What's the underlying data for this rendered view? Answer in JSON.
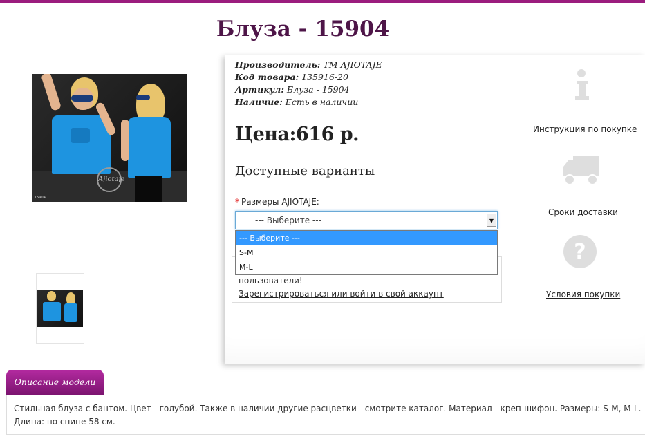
{
  "product": {
    "title": "Блуза - 15904",
    "meta": {
      "manufacturer_label": "Производитель:",
      "manufacturer_value": "ТМ AJIOTAJE",
      "code_label": "Код товара:",
      "code_value": "135916-20",
      "article_label": "Артикул:",
      "article_value": "Блуза - 15904",
      "stock_label": "Наличие:",
      "stock_value": "Есть в наличии"
    },
    "price": "Цена:616 р.",
    "photo_logo": "Ajiotaje",
    "photo_number": "15904"
  },
  "variants": {
    "title": "Доступные варианты",
    "size_label": "Размеры AJIOTAJE:",
    "required_mark": "*",
    "select_value": "--- Выберите ---",
    "options": [
      "--- Выберите ---",
      "S-M",
      "M-L"
    ]
  },
  "login_notice": {
    "text": "пользователи!",
    "link": "Зарегистрироваться или войти в свой аккаунт"
  },
  "sidebar": {
    "instructions": "Инструкция по покупке",
    "delivery": "Сроки доставки",
    "conditions": "Условия покупки"
  },
  "tabs": {
    "description_tab": "Описание модели",
    "description_text": "Стильная блуза с бантом. Цвет - голубой. Также в наличии другие расцветки - смотрите каталог. Материал - креп-шифон. Размеры: S-M, M-L. Длина: по спине 58 см."
  },
  "colors": {
    "accent": "#9b1c7e",
    "title": "#4e1548",
    "selected_option": "#3399ff",
    "icon_gray": "#e0e0e0"
  }
}
